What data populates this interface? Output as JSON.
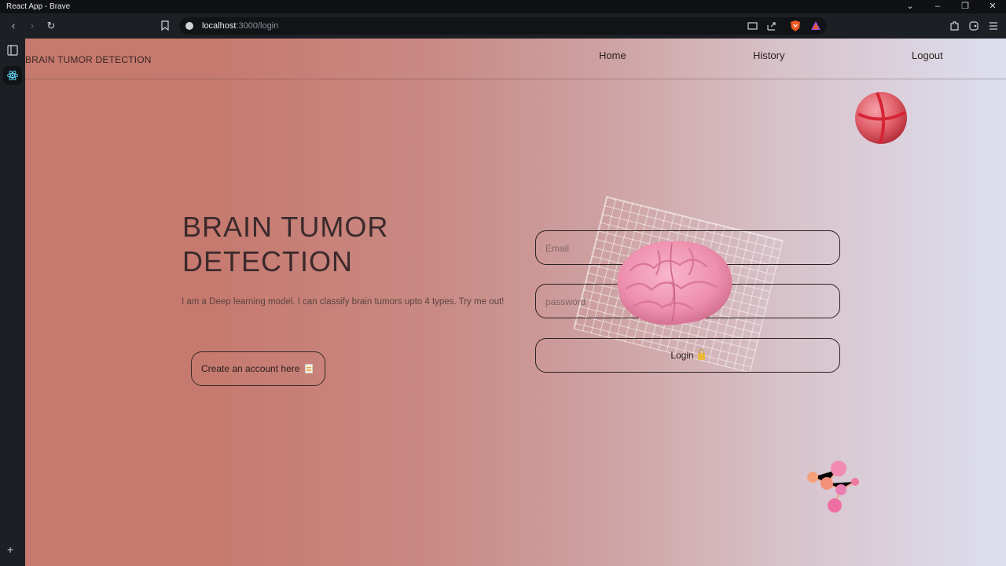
{
  "window": {
    "title": "React App - Brave"
  },
  "browser": {
    "url_host": "localhost",
    "url_path": ":3000/login"
  },
  "nav": {
    "brand": "BRAIN TUMOR DETECTION",
    "links": [
      "Home",
      "History",
      "Logout"
    ]
  },
  "hero": {
    "title_line1": "BRAIN TUMOR",
    "title_line2": "DETECTION",
    "subtitle": "I am a Deep learning model. I can classify brain tumors upto 4 types. Try me out!",
    "create_account_label": "Create an account here"
  },
  "form": {
    "email_placeholder": "Email",
    "password_placeholder": "password",
    "login_label": "Login"
  },
  "colors": {
    "gradient_start": "#c67a6d",
    "gradient_end": "#dcdfee",
    "text_dark": "#3b2a2c"
  },
  "icons": [
    "back-icon",
    "forward-icon",
    "reload-icon",
    "bookmark-icon",
    "site-info-icon",
    "cast-icon",
    "share-icon",
    "brave-shields-icon",
    "brave-rewards-icon",
    "extensions-icon",
    "wallet-icon",
    "menu-icon",
    "sidebar-toggle-icon",
    "react-icon",
    "add-panel-icon",
    "doc-icon",
    "lock-icon"
  ]
}
